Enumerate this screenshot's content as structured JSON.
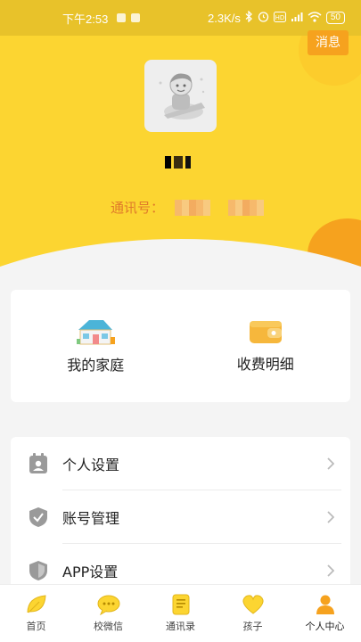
{
  "status_bar": {
    "time": "下午2:53",
    "network_speed": "2.3K/s",
    "battery": "50"
  },
  "header": {
    "message_button": "消息",
    "account_label": "通讯号：",
    "avatar_icon": "cartoon-boy-avatar"
  },
  "quick_actions": [
    {
      "label": "我的家庭",
      "icon": "house-icon"
    },
    {
      "label": "收费明细",
      "icon": "wallet-icon"
    }
  ],
  "settings_list": [
    {
      "label": "个人设置",
      "icon": "calendar-person-icon"
    },
    {
      "label": "账号管理",
      "icon": "shield-check-icon"
    },
    {
      "label": "APP设置",
      "icon": "shield-icon"
    }
  ],
  "tabbar": [
    {
      "label": "首页",
      "icon": "leaf-icon",
      "active": false
    },
    {
      "label": "校微信",
      "icon": "chat-bubble-icon",
      "active": false
    },
    {
      "label": "通讯录",
      "icon": "contacts-book-icon",
      "active": false
    },
    {
      "label": "孩子",
      "icon": "heart-icon",
      "active": false
    },
    {
      "label": "个人中心",
      "icon": "person-icon",
      "active": true
    }
  ],
  "colors": {
    "brand_yellow": "#fcd531",
    "accent_orange": "#f6a21e",
    "account_text": "#e07a2a",
    "icon_gray": "#9a9a9a"
  }
}
